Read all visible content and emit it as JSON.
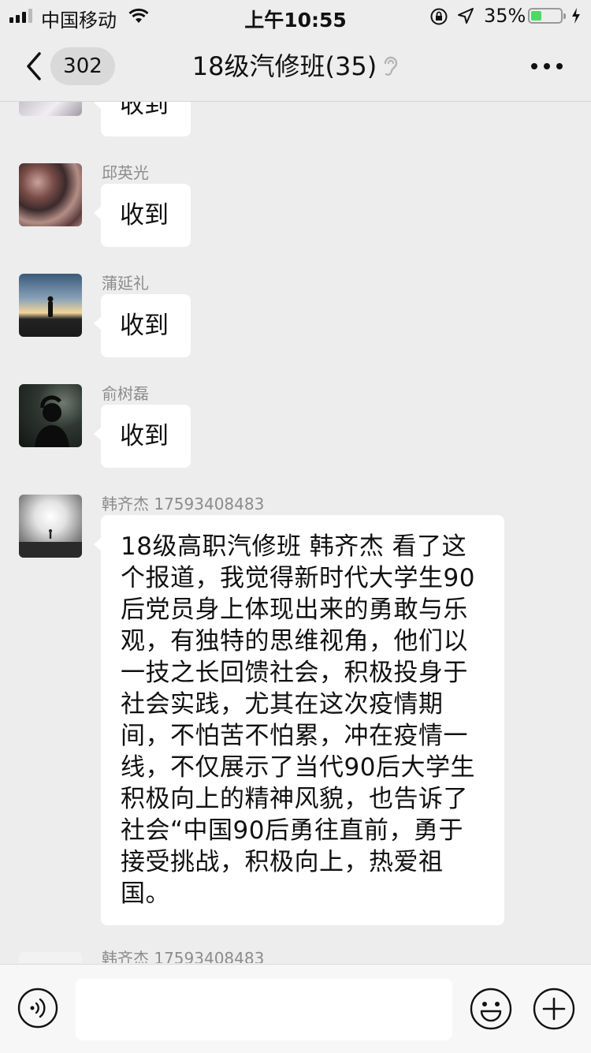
{
  "status_bar": {
    "carrier": "中国移动",
    "time": "上午10:55",
    "battery_percent_text": "35%",
    "battery_level": 0.35
  },
  "nav": {
    "unread_count": "302",
    "title": "18级汽修班(35)"
  },
  "messages": [
    {
      "sender": "",
      "text": "收到"
    },
    {
      "sender": "邱英光",
      "text": "收到"
    },
    {
      "sender": "蒲延礼",
      "text": "收到"
    },
    {
      "sender": "俞树磊",
      "text": "收到"
    },
    {
      "sender": "韩齐杰 17593408483",
      "text": "18级高职汽修班  韩齐杰     看了这个报道，我觉得新时代大学生90后党员身上体现出来的勇敢与乐观，有独特的思维视角，他们以一技之长回馈社会，积极投身于社会实践，尤其在这次疫情期间，不怕苦不怕累，冲在疫情一线，不仅展示了当代90后大学生积极向上的精神风貌，也告诉了社会“中国90后勇往直前，勇于接受挑战，积极向上，热爱祖国。"
    },
    {
      "sender": "韩齐杰 17593408483",
      "text": ""
    }
  ],
  "icons": {
    "back": "chevron-left-icon",
    "listen_mode": "ear-icon",
    "more": "more-dots-icon",
    "voice": "voice-icon",
    "emoji": "emoji-icon",
    "plus": "plus-icon"
  }
}
